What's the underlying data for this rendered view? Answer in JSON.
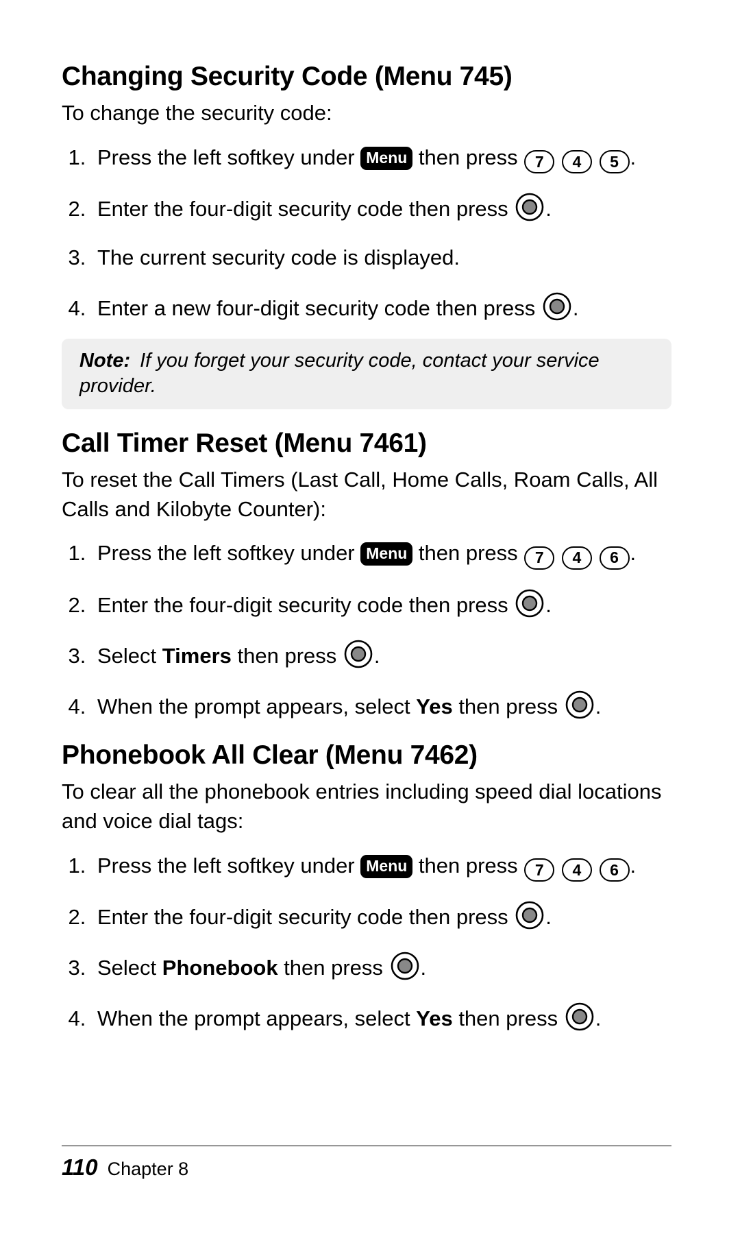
{
  "icons": {
    "menu_label": "Menu"
  },
  "section1": {
    "heading": "Changing Security Code (Menu 745)",
    "intro": "To change the security code:",
    "steps": {
      "s1a": "Press the left softkey under ",
      "s1b": " then press ",
      "k1": "7",
      "k2": "4",
      "k3": "5",
      "s1c": ".",
      "s2a": "Enter the four-digit security code then press ",
      "s2b": ".",
      "s3": "The current security code is displayed.",
      "s4a": "Enter a new four-digit security code then press ",
      "s4b": "."
    },
    "note_label": "Note:",
    "note_text": "If you forget your security code, contact your service provider."
  },
  "section2": {
    "heading": "Call Timer Reset (Menu 7461)",
    "intro": "To reset the Call Timers (Last Call, Home Calls, Roam Calls, All Calls and Kilobyte Counter):",
    "steps": {
      "s1a": "Press the left softkey under ",
      "s1b": " then press ",
      "k1": "7",
      "k2": "4",
      "k3": "6",
      "s1c": ".",
      "s2a": "Enter the four-digit security code then press ",
      "s2b": ".",
      "s3a": "Select ",
      "s3bold": "Timers",
      "s3b": " then press ",
      "s3c": ".",
      "s4a": "When the prompt appears, select ",
      "s4bold": "Yes",
      "s4b": " then press ",
      "s4c": "."
    }
  },
  "section3": {
    "heading": "Phonebook All Clear (Menu 7462)",
    "intro": "To clear all the phonebook entries including speed dial locations and voice dial tags:",
    "steps": {
      "s1a": "Press the left softkey under ",
      "s1b": " then press ",
      "k1": "7",
      "k2": "4",
      "k3": "6",
      "s1c": ".",
      "s2a": "Enter the four-digit security code then press ",
      "s2b": ".",
      "s3a": "Select ",
      "s3bold": "Phonebook",
      "s3b": " then press ",
      "s3c": ".",
      "s4a": "When the prompt appears, select ",
      "s4bold": "Yes",
      "s4b": " then press ",
      "s4c": "."
    }
  },
  "footer": {
    "page_number": "110",
    "chapter": "Chapter 8"
  }
}
